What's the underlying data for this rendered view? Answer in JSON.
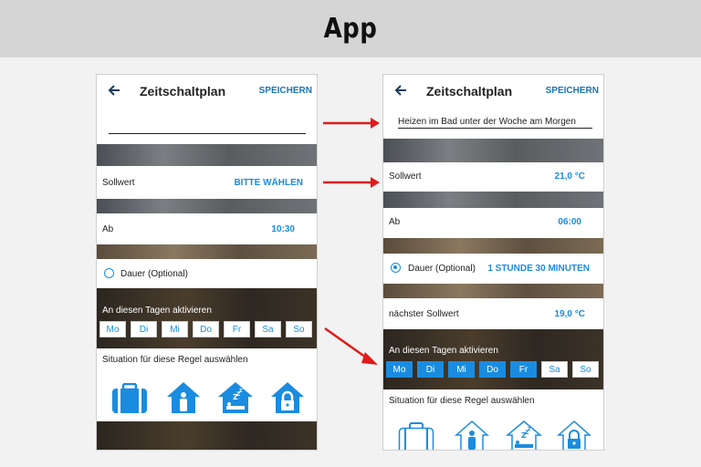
{
  "banner": {
    "title": "App"
  },
  "left": {
    "header": {
      "title": "Zeitschaltplan",
      "save_label": "SPEICHERN"
    },
    "name_input": {
      "value": ""
    },
    "setpoint": {
      "label": "Sollwert",
      "value": "BITTE WÄHLEN"
    },
    "start": {
      "label": "Ab",
      "value": "10:30"
    },
    "duration": {
      "label": "Dauer  (Optional)"
    },
    "days": {
      "title": "An diesen Tagen aktivieren",
      "items": [
        "Mo",
        "Di",
        "Mi",
        "Do",
        "Fr",
        "Sa",
        "So"
      ]
    },
    "situation": {
      "title": "Situation für diese Regel auswählen"
    }
  },
  "right": {
    "header": {
      "title": "Zeitschaltplan",
      "save_label": "SPEICHERN"
    },
    "name_input": {
      "value": "Heizen im Bad unter der Woche am Morgen"
    },
    "setpoint": {
      "label": "Sollwert",
      "value": "21,0 °C"
    },
    "start": {
      "label": "Ab",
      "value": "06:00"
    },
    "duration": {
      "label": "Dauer  (Optional)",
      "value": "1 STUNDE 30 MINUTEN"
    },
    "next_setpoint": {
      "label": "nächster Sollwert",
      "value": "19,0 °C"
    },
    "days": {
      "title": "An diesen Tagen aktivieren",
      "items": [
        "Mo",
        "Di",
        "Mi",
        "Do",
        "Fr",
        "Sa",
        "So"
      ],
      "active": [
        "Mo",
        "Di",
        "Mi",
        "Do",
        "Fr"
      ]
    },
    "situation": {
      "title": "Situation für diese Regel auswählen"
    }
  },
  "colors": {
    "accent": "#1a8ce0",
    "save": "#1a73b8",
    "arrow": "#e01b1b"
  },
  "icons": [
    "arrow-left-icon",
    "suitcase-icon",
    "house-person-icon",
    "house-sleep-icon",
    "house-lock-icon"
  ]
}
